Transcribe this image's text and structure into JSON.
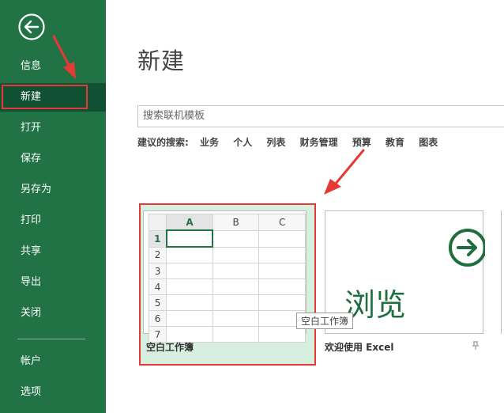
{
  "sidebar": {
    "items": [
      {
        "label": "信息"
      },
      {
        "label": "新建"
      },
      {
        "label": "打开"
      },
      {
        "label": "保存"
      },
      {
        "label": "另存为"
      },
      {
        "label": "打印"
      },
      {
        "label": "共享"
      },
      {
        "label": "导出"
      },
      {
        "label": "关闭"
      },
      {
        "label": "帐户"
      },
      {
        "label": "选项"
      }
    ],
    "selected_index": 1
  },
  "main": {
    "title": "新建",
    "search": {
      "placeholder": "搜索联机模板"
    },
    "suggested": {
      "label": "建议的搜索:",
      "terms": [
        "业务",
        "个人",
        "列表",
        "财务管理",
        "预算",
        "教育",
        "图表"
      ]
    },
    "templates": [
      {
        "label": "空白工作簿",
        "columns": [
          "A",
          "B",
          "C"
        ],
        "rows": [
          "1",
          "2",
          "3",
          "4",
          "5",
          "6",
          "7"
        ]
      },
      {
        "label": "欢迎使用 Excel",
        "preview_text": "浏览"
      }
    ],
    "tooltip": "空白工作簿"
  },
  "colors": {
    "accent": "#217346",
    "selected_bg": "#0f5132",
    "annotation": "#e53935"
  }
}
